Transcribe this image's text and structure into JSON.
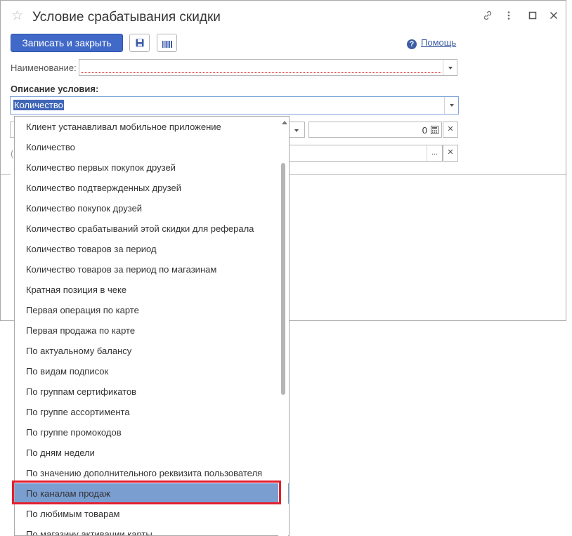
{
  "window": {
    "title": "Условие срабатывания скидки",
    "controls": [
      "link-icon",
      "more-icon",
      "maximize-icon",
      "close-icon"
    ]
  },
  "toolbar": {
    "save_close_label": "Записать и закрыть",
    "save_icon": "floppy-disk-icon",
    "barcode_icon": "barcode-icon",
    "help_label": "Помощь"
  },
  "form": {
    "name_label": "Наименование:",
    "name_value": "",
    "condition_label": "Описание условия:",
    "condition_value": "Количество",
    "quantity_value": "0"
  },
  "dropdown": {
    "items": [
      "Клиент устанавливал мобильное приложение",
      "Количество",
      "Количество первых покупок друзей",
      "Количество подтвержденных друзей",
      "Количество покупок друзей",
      "Количество срабатываний этой скидки для реферала",
      "Количество товаров за период",
      "Количество товаров за период по магазинам",
      "Кратная позиция в чеке",
      "Первая операция по карте",
      "Первая продажа по карте",
      "По актуальному балансу",
      "По видам подписок",
      "По группам сертификатов",
      "По группе ассортимента",
      "По группе промокодов",
      "По дням недели",
      "По значению дополнительного реквизита пользователя",
      "По каналам продаж",
      "По любимым товарам",
      "По магазину активации карты"
    ],
    "highlighted_index": 18,
    "highlight_color": "#7b9ed1",
    "annotation_color": "#e41f2f"
  },
  "colors": {
    "primary_button": "#4169c7",
    "link": "#3d5ea3"
  }
}
